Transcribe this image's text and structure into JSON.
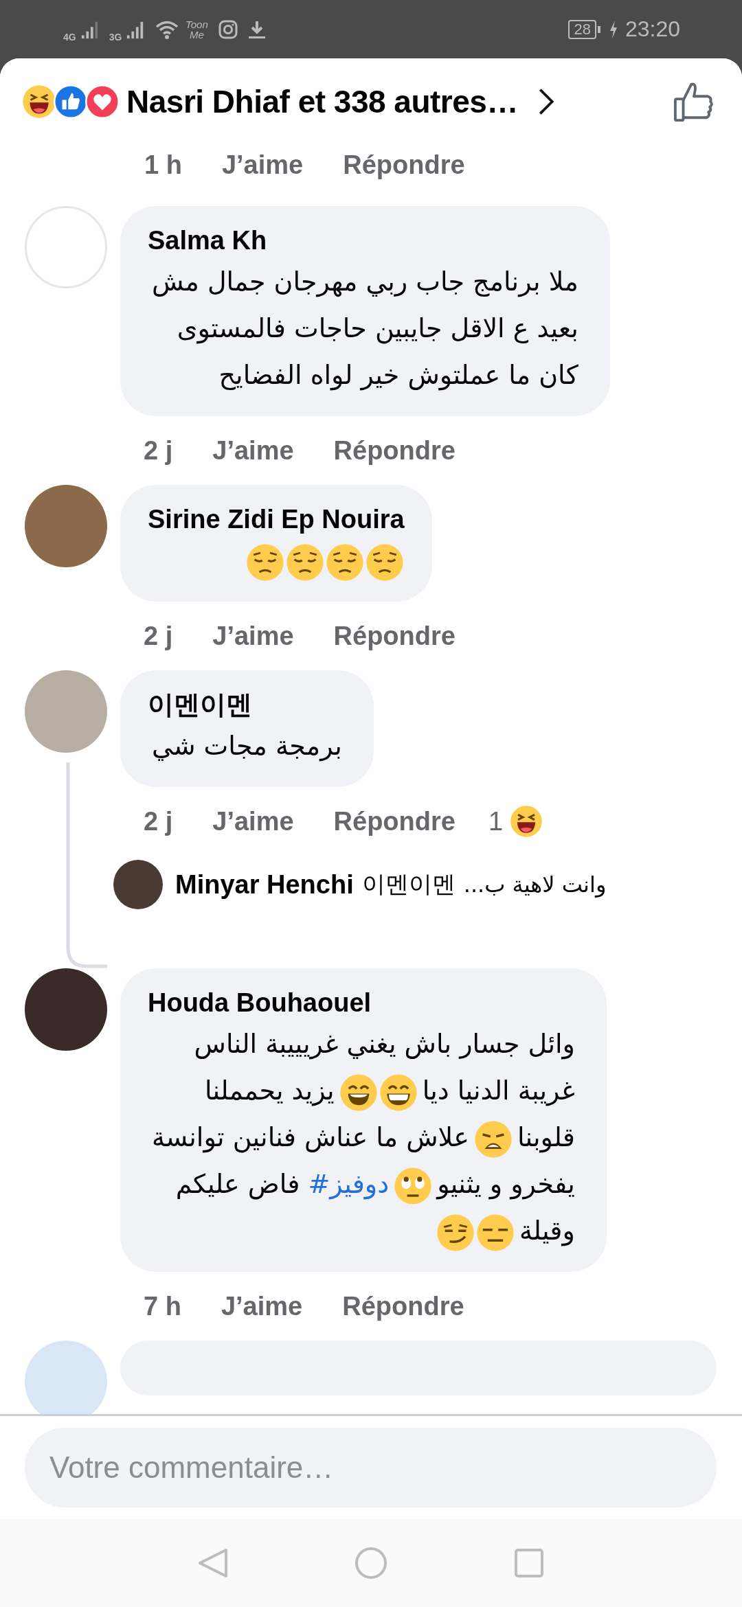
{
  "status_bar": {
    "network_1": "4G",
    "network_2": "3G",
    "app_label": "Toon Me",
    "battery": "28",
    "time": "23:20"
  },
  "header": {
    "title": "Nasri Dhiaf et 338 autres…"
  },
  "partial_actions": {
    "time": "1 h",
    "like": "J’aime",
    "reply": "Répondre"
  },
  "comments": [
    {
      "author": "Salma Kh",
      "lines": [
        [
          {
            "kind": "text",
            "text": "ملا برنامج جاب ربي مهرجان جمال مش"
          }
        ],
        [
          {
            "kind": "text",
            "text": "بعيد ع الاقل جايبين حاجات فالمستوى"
          }
        ],
        [
          {
            "kind": "text",
            "text": "كان ما عملتوش خير لواه الفضايح"
          }
        ]
      ],
      "time": "2 j",
      "like": "J’aime",
      "reply": "Répondre"
    },
    {
      "author": "Sirine Zidi Ep Nouira",
      "lines": [
        [
          {
            "kind": "pensive"
          },
          {
            "kind": "pensive"
          },
          {
            "kind": "pensive"
          },
          {
            "kind": "pensive"
          }
        ]
      ],
      "time": "2 j",
      "like": "J’aime",
      "reply": "Répondre"
    },
    {
      "author": "이멘이멘",
      "lines": [
        [
          {
            "kind": "text",
            "text": "برمجة مجات شي"
          }
        ]
      ],
      "time": "2 j",
      "like": "J’aime",
      "reply": "Répondre",
      "reaction_count": "1",
      "replies": [
        {
          "author": "Minyar Henchi",
          "mention": "이멘이멘",
          "text": "وانت لاهية ب..."
        }
      ]
    },
    {
      "author": "Houda Bouhaouel",
      "lines": [
        [
          {
            "kind": "text",
            "text": "وائل جسار باش يغني غريييبة الناس"
          }
        ],
        [
          {
            "kind": "text",
            "text": "غريبة الدنيا ديا"
          },
          {
            "kind": "grin"
          },
          {
            "kind": "smile"
          },
          {
            "kind": "text",
            "text": "يزيد يحمملنا"
          }
        ],
        [
          {
            "kind": "text",
            "text": "قلوبنا"
          },
          {
            "kind": "weary"
          },
          {
            "kind": "text",
            "text": "علاش ما عناش فنانين توانسة"
          }
        ],
        [
          {
            "kind": "text",
            "text": "يفخرو و يثنيو"
          },
          {
            "kind": "eyeroll"
          },
          {
            "kind": "hashtag",
            "text": "#دوفيز"
          },
          {
            "kind": "text",
            "text": "فاض عليكم"
          }
        ],
        [
          {
            "kind": "text",
            "text": "وقيلة"
          },
          {
            "kind": "expressionless"
          },
          {
            "kind": "smirk"
          }
        ]
      ],
      "time": "7 h",
      "like": "J’aime",
      "reply": "Répondre"
    }
  ],
  "composer": {
    "placeholder": "Votre commentaire…"
  }
}
